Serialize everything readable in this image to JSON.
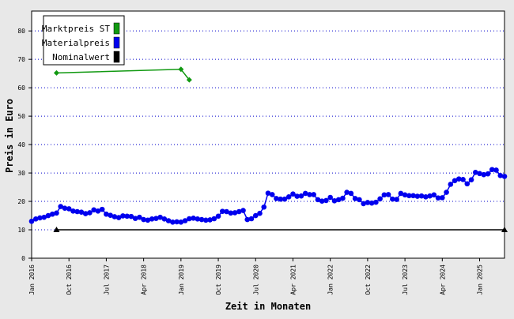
{
  "chart_data": {
    "type": "line",
    "xlabel": "Zeit in Monaten",
    "ylabel": "Preis in Euro",
    "ylim": [
      0,
      87
    ],
    "yticks": [
      0,
      10,
      20,
      30,
      40,
      50,
      60,
      70,
      80
    ],
    "grid": true,
    "legend_position": "top-left",
    "x_start": "Jan 2016",
    "x_end": "Jul 2025",
    "xticks": [
      "Jan 2016",
      "Oct 2016",
      "Jul 2017",
      "Apr 2018",
      "Jan 2019",
      "Oct 2019",
      "Jul 2020",
      "Apr 2021",
      "Jan 2022",
      "Oct 2022",
      "Jul 2023",
      "Apr 2024",
      "Jan 2025"
    ],
    "series": [
      {
        "name": "Marktpreis ST",
        "color": "#119911",
        "marker": "diamond",
        "points": [
          [
            "Jul 2016",
            65.2
          ],
          [
            "Jan 2019",
            66.5
          ],
          [
            "Mar 2019",
            62.8
          ]
        ]
      },
      {
        "name": "Materialpreis",
        "color": "#0000ee",
        "marker": "circle",
        "points": [
          [
            "Jan 2016",
            13.0
          ],
          [
            "Feb 2016",
            13.8
          ],
          [
            "Mar 2016",
            14.2
          ],
          [
            "Apr 2016",
            14.4
          ],
          [
            "May 2016",
            15.0
          ],
          [
            "Jun 2016",
            15.5
          ],
          [
            "Jul 2016",
            15.9
          ],
          [
            "Aug 2016",
            18.2
          ],
          [
            "Sep 2016",
            17.6
          ],
          [
            "Oct 2016",
            17.4
          ],
          [
            "Nov 2016",
            16.6
          ],
          [
            "Dec 2016",
            16.4
          ],
          [
            "Jan 2017",
            16.2
          ],
          [
            "Feb 2017",
            15.7
          ],
          [
            "Mar 2017",
            16.0
          ],
          [
            "Apr 2017",
            17.0
          ],
          [
            "May 2017",
            16.6
          ],
          [
            "Jun 2017",
            17.2
          ],
          [
            "Jul 2017",
            15.5
          ],
          [
            "Aug 2017",
            15.1
          ],
          [
            "Sep 2017",
            14.6
          ],
          [
            "Oct 2017",
            14.3
          ],
          [
            "Nov 2017",
            14.9
          ],
          [
            "Dec 2017",
            14.8
          ],
          [
            "Jan 2018",
            14.7
          ],
          [
            "Feb 2018",
            14.0
          ],
          [
            "Mar 2018",
            14.4
          ],
          [
            "Apr 2018",
            13.6
          ],
          [
            "May 2018",
            13.4
          ],
          [
            "Jun 2018",
            13.8
          ],
          [
            "Jul 2018",
            14.0
          ],
          [
            "Aug 2018",
            14.4
          ],
          [
            "Sep 2018",
            13.8
          ],
          [
            "Oct 2018",
            13.2
          ],
          [
            "Nov 2018",
            12.7
          ],
          [
            "Dec 2018",
            12.8
          ],
          [
            "Jan 2019",
            12.7
          ],
          [
            "Feb 2019",
            13.2
          ],
          [
            "Mar 2019",
            13.9
          ],
          [
            "Apr 2019",
            14.1
          ],
          [
            "May 2019",
            13.8
          ],
          [
            "Jun 2019",
            13.6
          ],
          [
            "Jul 2019",
            13.4
          ],
          [
            "Aug 2019",
            13.5
          ],
          [
            "Sep 2019",
            13.9
          ],
          [
            "Oct 2019",
            14.8
          ],
          [
            "Nov 2019",
            16.5
          ],
          [
            "Dec 2019",
            16.4
          ],
          [
            "Jan 2020",
            15.9
          ],
          [
            "Feb 2020",
            16.0
          ],
          [
            "Mar 2020",
            16.4
          ],
          [
            "Apr 2020",
            16.8
          ],
          [
            "May 2020",
            13.6
          ],
          [
            "Jun 2020",
            13.9
          ],
          [
            "Jul 2020",
            15.0
          ],
          [
            "Aug 2020",
            15.8
          ],
          [
            "Sep 2020",
            18.0
          ],
          [
            "Oct 2020",
            22.9
          ],
          [
            "Nov 2020",
            22.4
          ],
          [
            "Dec 2020",
            21.0
          ],
          [
            "Jan 2021",
            20.8
          ],
          [
            "Feb 2021",
            20.8
          ],
          [
            "Mar 2021",
            21.6
          ],
          [
            "Apr 2021",
            22.6
          ],
          [
            "May 2021",
            21.8
          ],
          [
            "Jun 2021",
            21.9
          ],
          [
            "Jul 2021",
            22.8
          ],
          [
            "Aug 2021",
            22.4
          ],
          [
            "Sep 2021",
            22.4
          ],
          [
            "Oct 2021",
            20.6
          ],
          [
            "Nov 2021",
            20.1
          ],
          [
            "Dec 2021",
            20.3
          ],
          [
            "Jan 2022",
            21.4
          ],
          [
            "Feb 2022",
            20.2
          ],
          [
            "Mar 2022",
            20.6
          ],
          [
            "Apr 2022",
            21.1
          ],
          [
            "May 2022",
            23.2
          ],
          [
            "Jun 2022",
            22.8
          ],
          [
            "Jul 2022",
            21.0
          ],
          [
            "Aug 2022",
            20.6
          ],
          [
            "Sep 2022",
            19.2
          ],
          [
            "Oct 2022",
            19.6
          ],
          [
            "Nov 2022",
            19.4
          ],
          [
            "Dec 2022",
            19.7
          ],
          [
            "Jan 2023",
            20.9
          ],
          [
            "Feb 2023",
            22.3
          ],
          [
            "Mar 2023",
            22.4
          ],
          [
            "Apr 2023",
            20.8
          ],
          [
            "May 2023",
            20.7
          ],
          [
            "Jun 2023",
            22.8
          ],
          [
            "Jul 2023",
            22.3
          ],
          [
            "Aug 2023",
            22.0
          ],
          [
            "Sep 2023",
            22.0
          ],
          [
            "Oct 2023",
            21.8
          ],
          [
            "Nov 2023",
            21.9
          ],
          [
            "Dec 2023",
            21.6
          ],
          [
            "Jan 2024",
            21.9
          ],
          [
            "Feb 2024",
            22.3
          ],
          [
            "Mar 2024",
            21.2
          ],
          [
            "Apr 2024",
            21.3
          ],
          [
            "May 2024",
            23.2
          ],
          [
            "Jun 2024",
            26.0
          ],
          [
            "Jul 2024",
            27.3
          ],
          [
            "Aug 2024",
            27.9
          ],
          [
            "Sep 2024",
            27.7
          ],
          [
            "Oct 2024",
            26.2
          ],
          [
            "Nov 2024",
            27.6
          ],
          [
            "Dec 2024",
            30.2
          ],
          [
            "Jan 2025",
            29.8
          ],
          [
            "Feb 2025",
            29.4
          ],
          [
            "Mar 2025",
            29.7
          ],
          [
            "Apr 2025",
            31.2
          ],
          [
            "May 2025",
            31.0
          ],
          [
            "Jun 2025",
            29.1
          ],
          [
            "Jul 2025",
            28.8
          ]
        ]
      },
      {
        "name": "Nominalwert",
        "color": "#000000",
        "marker": "triangle",
        "points": [
          [
            "Jul 2016",
            10
          ],
          [
            "Jul 2025",
            10
          ]
        ]
      }
    ]
  }
}
